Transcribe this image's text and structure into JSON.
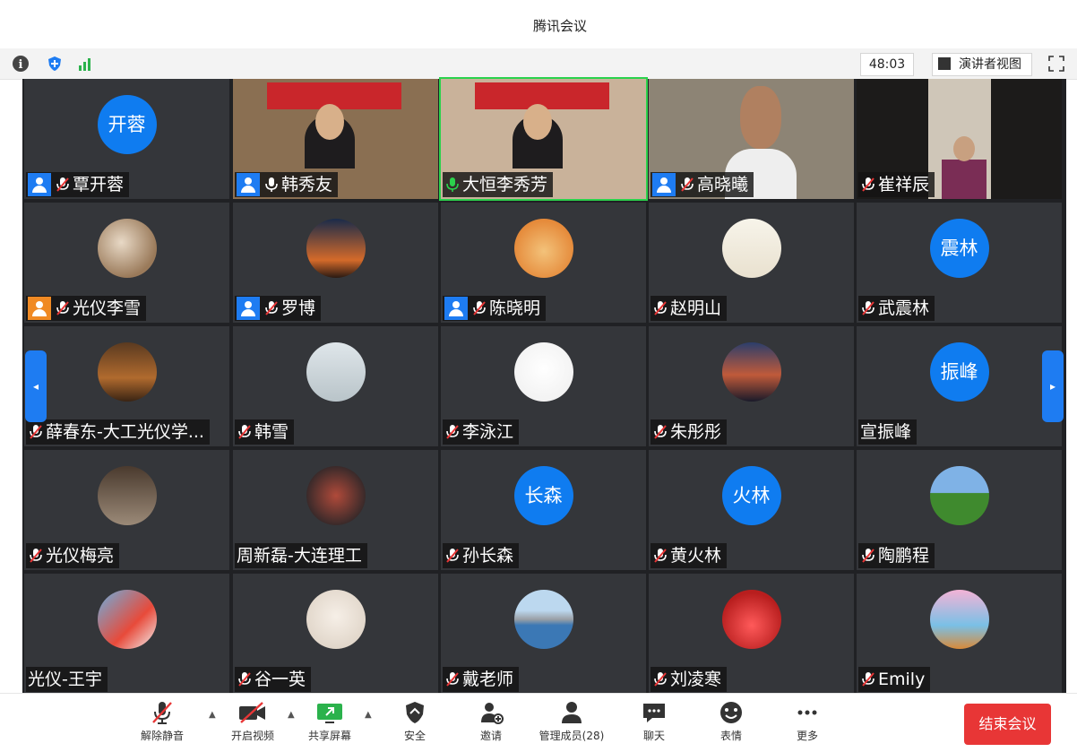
{
  "window": {
    "title": "腾讯会议"
  },
  "status": {
    "timer": "48:03",
    "view_label": "演讲者视图"
  },
  "colors": {
    "accent": "#1e7cf2",
    "danger": "#e83636",
    "muted_mic": "#ffffff"
  },
  "participants": [
    {
      "name": "覃开蓉",
      "host": true,
      "mic": "muted",
      "avatar_text": "开蓉"
    },
    {
      "name": "韩秀友",
      "host": true,
      "mic": "on",
      "video": true
    },
    {
      "name": "大恒李秀芳",
      "host": false,
      "mic": "speaking",
      "video": true
    },
    {
      "name": "高晓曦",
      "host": true,
      "mic": "muted",
      "video": true
    },
    {
      "name": "崔祥辰",
      "host": false,
      "mic": "muted",
      "video": true
    },
    {
      "name": "光仪李雪",
      "host": true,
      "mic": "muted"
    },
    {
      "name": "罗博",
      "host": true,
      "mic": "muted"
    },
    {
      "name": "陈晓明",
      "host": true,
      "mic": "muted"
    },
    {
      "name": "赵明山",
      "host": false,
      "mic": "muted"
    },
    {
      "name": "武震林",
      "host": false,
      "mic": "muted",
      "avatar_text": "震林"
    },
    {
      "name": "薛春东-大工光仪学...",
      "host": false,
      "mic": "muted"
    },
    {
      "name": "韩雪",
      "host": false,
      "mic": "muted"
    },
    {
      "name": "李泳江",
      "host": false,
      "mic": "muted"
    },
    {
      "name": "朱彤彤",
      "host": false,
      "mic": "muted"
    },
    {
      "name": "宣振峰",
      "host": false,
      "mic": "none",
      "avatar_text": "振峰"
    },
    {
      "name": "光仪梅亮",
      "host": false,
      "mic": "muted"
    },
    {
      "name": "周新磊-大连理工",
      "host": false,
      "mic": "none"
    },
    {
      "name": "孙长森",
      "host": false,
      "mic": "muted",
      "avatar_text": "长森"
    },
    {
      "name": "黄火林",
      "host": false,
      "mic": "muted",
      "avatar_text": "火林"
    },
    {
      "name": "陶鹏程",
      "host": false,
      "mic": "muted"
    },
    {
      "name": "光仪-王宇",
      "host": false,
      "mic": "none"
    },
    {
      "name": "谷一英",
      "host": false,
      "mic": "muted"
    },
    {
      "name": "戴老师",
      "host": false,
      "mic": "muted"
    },
    {
      "name": "刘凌寒",
      "host": false,
      "mic": "muted"
    },
    {
      "name": "Emily",
      "host": false,
      "mic": "muted"
    }
  ],
  "toolbar": {
    "unmute": "解除静音",
    "start_video": "开启视频",
    "share_screen": "共享屏幕",
    "security": "安全",
    "invite": "邀请",
    "members": "管理成员(28)",
    "chat": "聊天",
    "reactions": "表情",
    "more": "更多",
    "end_meeting": "结束会议"
  }
}
